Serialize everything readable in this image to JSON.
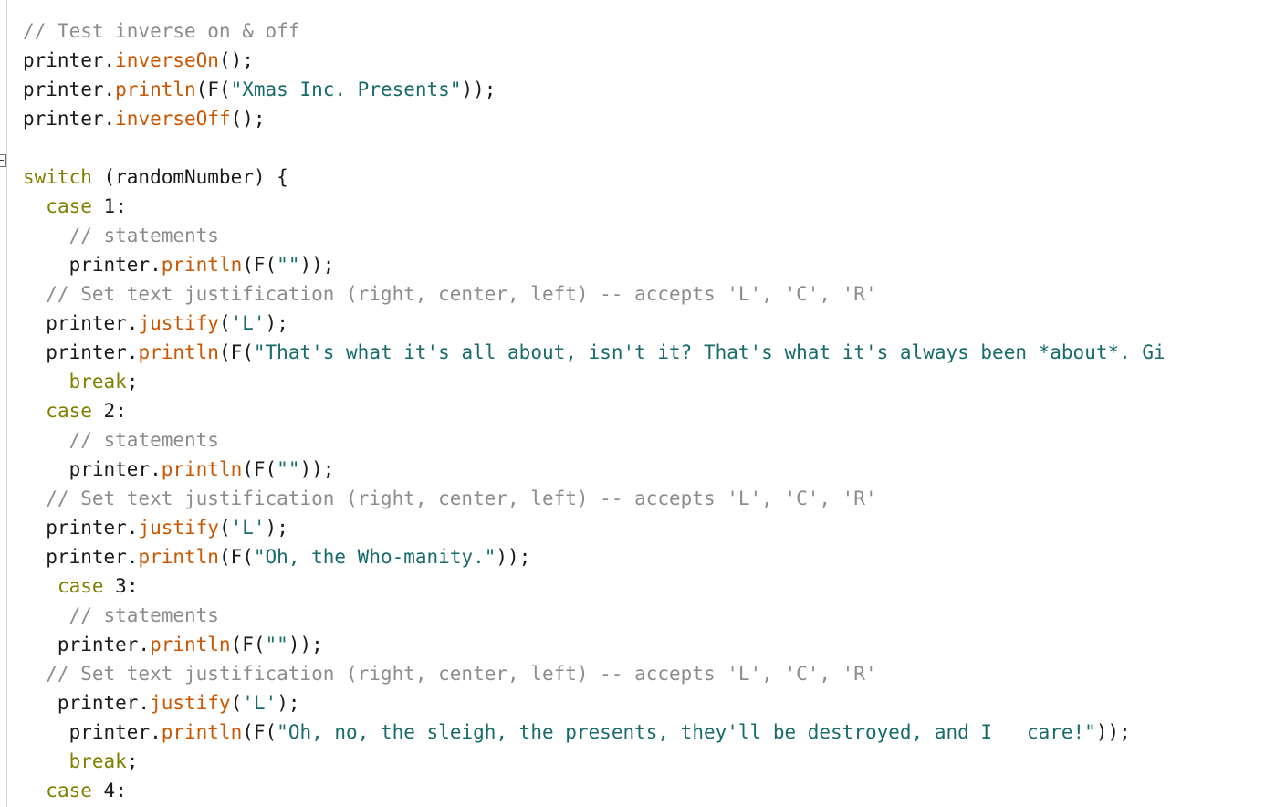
{
  "editor": {
    "kind": "code-editor",
    "language": "arduino-cpp",
    "background_color": "#ffffff",
    "fold_marker": {
      "icon": "fold-collapse-icon",
      "state": "expanded",
      "on_line_index": 5
    },
    "colors": {
      "text": "#1a1a1a",
      "comment": "#8c8c8c",
      "keyword": "#7f8000",
      "function": "#cc5500",
      "string": "#176b6b",
      "gutter_rule": "#d4d4d4"
    }
  },
  "lines": [
    {
      "indent": 0,
      "tokens": [
        {
          "t": "cm",
          "s": "// Test inverse on & off"
        }
      ]
    },
    {
      "indent": 0,
      "tokens": [
        {
          "t": "pl",
          "s": "printer."
        },
        {
          "t": "fn",
          "s": "inverseOn"
        },
        {
          "t": "pl",
          "s": "();"
        }
      ]
    },
    {
      "indent": 0,
      "tokens": [
        {
          "t": "pl",
          "s": "printer."
        },
        {
          "t": "fn",
          "s": "println"
        },
        {
          "t": "pl",
          "s": "(F("
        },
        {
          "t": "str",
          "s": "\"Xmas Inc. Presents\""
        },
        {
          "t": "pl",
          "s": "));"
        }
      ]
    },
    {
      "indent": 0,
      "tokens": [
        {
          "t": "pl",
          "s": "printer."
        },
        {
          "t": "fn",
          "s": "inverseOff"
        },
        {
          "t": "pl",
          "s": "();"
        }
      ]
    },
    {
      "indent": 0,
      "tokens": []
    },
    {
      "indent": 0,
      "fold": true,
      "tokens": [
        {
          "t": "kw",
          "s": "switch"
        },
        {
          "t": "pl",
          "s": " (randomNumber) {"
        }
      ]
    },
    {
      "indent": 0,
      "tokens": [
        {
          "t": "pl",
          "s": "  "
        },
        {
          "t": "kw",
          "s": "case"
        },
        {
          "t": "pl",
          "s": " "
        },
        {
          "t": "num",
          "s": "1"
        },
        {
          "t": "pl",
          "s": ":"
        }
      ]
    },
    {
      "indent": 0,
      "tokens": [
        {
          "t": "cm",
          "s": "    // statements"
        }
      ]
    },
    {
      "indent": 0,
      "tokens": [
        {
          "t": "pl",
          "s": "    printer."
        },
        {
          "t": "fn",
          "s": "println"
        },
        {
          "t": "pl",
          "s": "(F("
        },
        {
          "t": "str",
          "s": "\"\""
        },
        {
          "t": "pl",
          "s": "));"
        }
      ]
    },
    {
      "indent": 0,
      "tokens": [
        {
          "t": "cm",
          "s": "  // Set text justification (right, center, left) -- accepts 'L', 'C', 'R'"
        }
      ]
    },
    {
      "indent": 0,
      "tokens": [
        {
          "t": "pl",
          "s": "  printer."
        },
        {
          "t": "fn",
          "s": "justify"
        },
        {
          "t": "pl",
          "s": "("
        },
        {
          "t": "str",
          "s": "'L'"
        },
        {
          "t": "pl",
          "s": ");"
        }
      ]
    },
    {
      "indent": 0,
      "tokens": [
        {
          "t": "pl",
          "s": "  printer."
        },
        {
          "t": "fn",
          "s": "println"
        },
        {
          "t": "pl",
          "s": "(F("
        },
        {
          "t": "str",
          "s": "\"That's what it's all about, isn't it? That's what it's always been *about*. Gi"
        }
      ]
    },
    {
      "indent": 0,
      "tokens": [
        {
          "t": "pl",
          "s": "    "
        },
        {
          "t": "kw",
          "s": "break"
        },
        {
          "t": "pl",
          "s": ";"
        }
      ]
    },
    {
      "indent": 0,
      "tokens": [
        {
          "t": "pl",
          "s": "  "
        },
        {
          "t": "kw",
          "s": "case"
        },
        {
          "t": "pl",
          "s": " "
        },
        {
          "t": "num",
          "s": "2"
        },
        {
          "t": "pl",
          "s": ":"
        }
      ]
    },
    {
      "indent": 0,
      "tokens": [
        {
          "t": "cm",
          "s": "    // statements"
        }
      ]
    },
    {
      "indent": 0,
      "tokens": [
        {
          "t": "pl",
          "s": "    printer."
        },
        {
          "t": "fn",
          "s": "println"
        },
        {
          "t": "pl",
          "s": "(F("
        },
        {
          "t": "str",
          "s": "\"\""
        },
        {
          "t": "pl",
          "s": "));"
        }
      ]
    },
    {
      "indent": 0,
      "tokens": [
        {
          "t": "cm",
          "s": "  // Set text justification (right, center, left) -- accepts 'L', 'C', 'R'"
        }
      ]
    },
    {
      "indent": 0,
      "tokens": [
        {
          "t": "pl",
          "s": "  printer."
        },
        {
          "t": "fn",
          "s": "justify"
        },
        {
          "t": "pl",
          "s": "("
        },
        {
          "t": "str",
          "s": "'L'"
        },
        {
          "t": "pl",
          "s": ");"
        }
      ]
    },
    {
      "indent": 0,
      "tokens": [
        {
          "t": "pl",
          "s": "  printer."
        },
        {
          "t": "fn",
          "s": "println"
        },
        {
          "t": "pl",
          "s": "(F("
        },
        {
          "t": "str",
          "s": "\"Oh, the Who-manity.\""
        },
        {
          "t": "pl",
          "s": "));"
        }
      ]
    },
    {
      "indent": 0,
      "tokens": [
        {
          "t": "pl",
          "s": "   "
        },
        {
          "t": "kw",
          "s": "case"
        },
        {
          "t": "pl",
          "s": " "
        },
        {
          "t": "num",
          "s": "3"
        },
        {
          "t": "pl",
          "s": ":"
        }
      ]
    },
    {
      "indent": 0,
      "tokens": [
        {
          "t": "cm",
          "s": "    // statements"
        }
      ]
    },
    {
      "indent": 0,
      "tokens": [
        {
          "t": "pl",
          "s": "   printer."
        },
        {
          "t": "fn",
          "s": "println"
        },
        {
          "t": "pl",
          "s": "(F("
        },
        {
          "t": "str",
          "s": "\"\""
        },
        {
          "t": "pl",
          "s": "));"
        }
      ]
    },
    {
      "indent": 0,
      "tokens": [
        {
          "t": "cm",
          "s": "  // Set text justification (right, center, left) -- accepts 'L', 'C', 'R'"
        }
      ]
    },
    {
      "indent": 0,
      "tokens": [
        {
          "t": "pl",
          "s": "   printer."
        },
        {
          "t": "fn",
          "s": "justify"
        },
        {
          "t": "pl",
          "s": "("
        },
        {
          "t": "str",
          "s": "'L'"
        },
        {
          "t": "pl",
          "s": ");"
        }
      ]
    },
    {
      "indent": 0,
      "tokens": [
        {
          "t": "pl",
          "s": "    printer."
        },
        {
          "t": "fn",
          "s": "println"
        },
        {
          "t": "pl",
          "s": "(F("
        },
        {
          "t": "str",
          "s": "\"Oh, no, the sleigh, the presents, they'll be destroyed, and I   care!\""
        },
        {
          "t": "pl",
          "s": "));"
        }
      ]
    },
    {
      "indent": 0,
      "tokens": [
        {
          "t": "pl",
          "s": "    "
        },
        {
          "t": "kw",
          "s": "break"
        },
        {
          "t": "pl",
          "s": ";"
        }
      ]
    },
    {
      "indent": 0,
      "tokens": [
        {
          "t": "pl",
          "s": "  "
        },
        {
          "t": "kw",
          "s": "case"
        },
        {
          "t": "pl",
          "s": " "
        },
        {
          "t": "num",
          "s": "4"
        },
        {
          "t": "pl",
          "s": ":"
        }
      ]
    }
  ]
}
